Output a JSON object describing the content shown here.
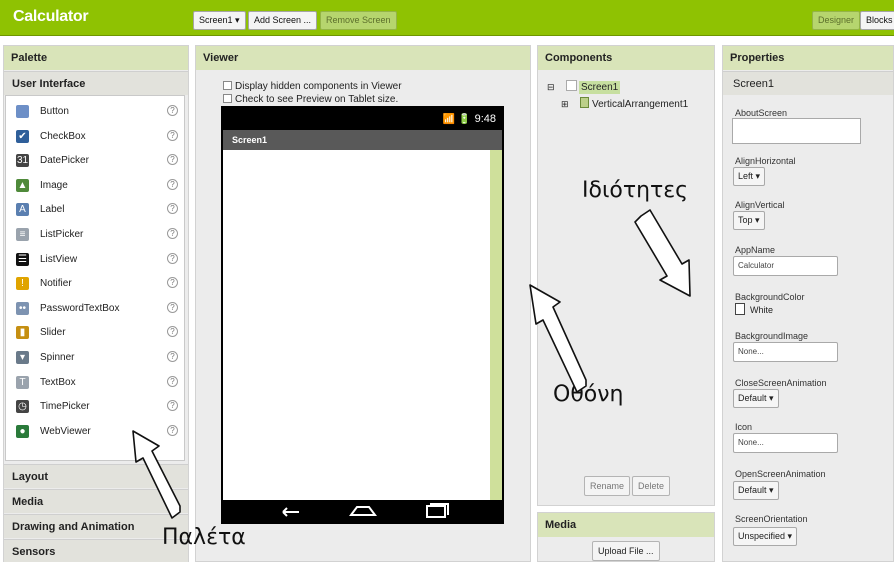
{
  "app": {
    "title": "Calculator"
  },
  "toolbar": {
    "screen_select": "Screen1 ▾",
    "add_screen": "Add Screen ...",
    "remove_screen": "Remove Screen",
    "designer": "Designer",
    "blocks": "Blocks"
  },
  "palette": {
    "header": "Palette",
    "category_open": "User Interface",
    "items": [
      {
        "label": "Button",
        "icon": "button-icon",
        "color": "#6d8fc7",
        "glyph": ""
      },
      {
        "label": "CheckBox",
        "icon": "checkbox-icon",
        "color": "#2f5f9a",
        "glyph": "✔"
      },
      {
        "label": "DatePicker",
        "icon": "datepicker-icon",
        "color": "#444444",
        "glyph": "31"
      },
      {
        "label": "Image",
        "icon": "image-icon",
        "color": "#4f8a3a",
        "glyph": "▲"
      },
      {
        "label": "Label",
        "icon": "label-icon",
        "color": "#5a7fb0",
        "glyph": "A"
      },
      {
        "label": "ListPicker",
        "icon": "listpicker-icon",
        "color": "#9aa3ad",
        "glyph": "≡"
      },
      {
        "label": "ListView",
        "icon": "listview-icon",
        "color": "#111111",
        "glyph": "☰"
      },
      {
        "label": "Notifier",
        "icon": "warning-icon",
        "color": "#e0a400",
        "glyph": "!"
      },
      {
        "label": "PasswordTextBox",
        "icon": "password-icon",
        "color": "#7d93b1",
        "glyph": "••"
      },
      {
        "label": "Slider",
        "icon": "slider-icon",
        "color": "#c58f12",
        "glyph": "▮"
      },
      {
        "label": "Spinner",
        "icon": "spinner-icon",
        "color": "#6a7a8a",
        "glyph": "▾"
      },
      {
        "label": "TextBox",
        "icon": "textbox-icon",
        "color": "#9aa3ad",
        "glyph": "T"
      },
      {
        "label": "TimePicker",
        "icon": "timepicker-icon",
        "color": "#444444",
        "glyph": "◷"
      },
      {
        "label": "WebViewer",
        "icon": "globe-icon",
        "color": "#2a7a3a",
        "glyph": "●"
      }
    ],
    "help_glyph": "?",
    "categories": [
      "Layout",
      "Media",
      "Drawing and Animation",
      "Sensors"
    ]
  },
  "viewer": {
    "header": "Viewer",
    "check_hidden": "Display hidden components in Viewer",
    "check_tablet": "Check to see Preview on Tablet size.",
    "status_time": "9:48",
    "status_icons": "📶 🔋",
    "screen_title": "Screen1"
  },
  "components": {
    "header": "Components",
    "root": "Screen1",
    "child": "VerticalArrangement1",
    "rename": "Rename",
    "delete": "Delete",
    "media_header": "Media",
    "upload": "Upload File ..."
  },
  "properties": {
    "header": "Properties",
    "screen": "Screen1",
    "about_screen": "AboutScreen",
    "align_horizontal": "AlignHorizontal",
    "align_horizontal_value": "Left ▾",
    "align_vertical": "AlignVertical",
    "align_vertical_value": "Top ▾",
    "app_name": "AppName",
    "app_name_value": "Calculator",
    "background_color": "BackgroundColor",
    "background_color_value": "White",
    "background_image": "BackgroundImage",
    "background_image_value": "None...",
    "close_screen_animation": "CloseScreenAnimation",
    "close_screen_animation_value": "Default ▾",
    "icon": "Icon",
    "icon_value": "None...",
    "open_screen_animation": "OpenScreenAnimation",
    "open_screen_animation_value": "Default ▾",
    "screen_orientation": "ScreenOrientation",
    "screen_orientation_value": "Unspecified ▾"
  },
  "annotations": {
    "properties": "Ιδιότητες",
    "screen": "Οθόνη",
    "palette": "Παλέτα"
  },
  "colors": {
    "topbar": "#8fc202",
    "panel_header": "#d9e4b9",
    "phone_frame": "#000000"
  }
}
